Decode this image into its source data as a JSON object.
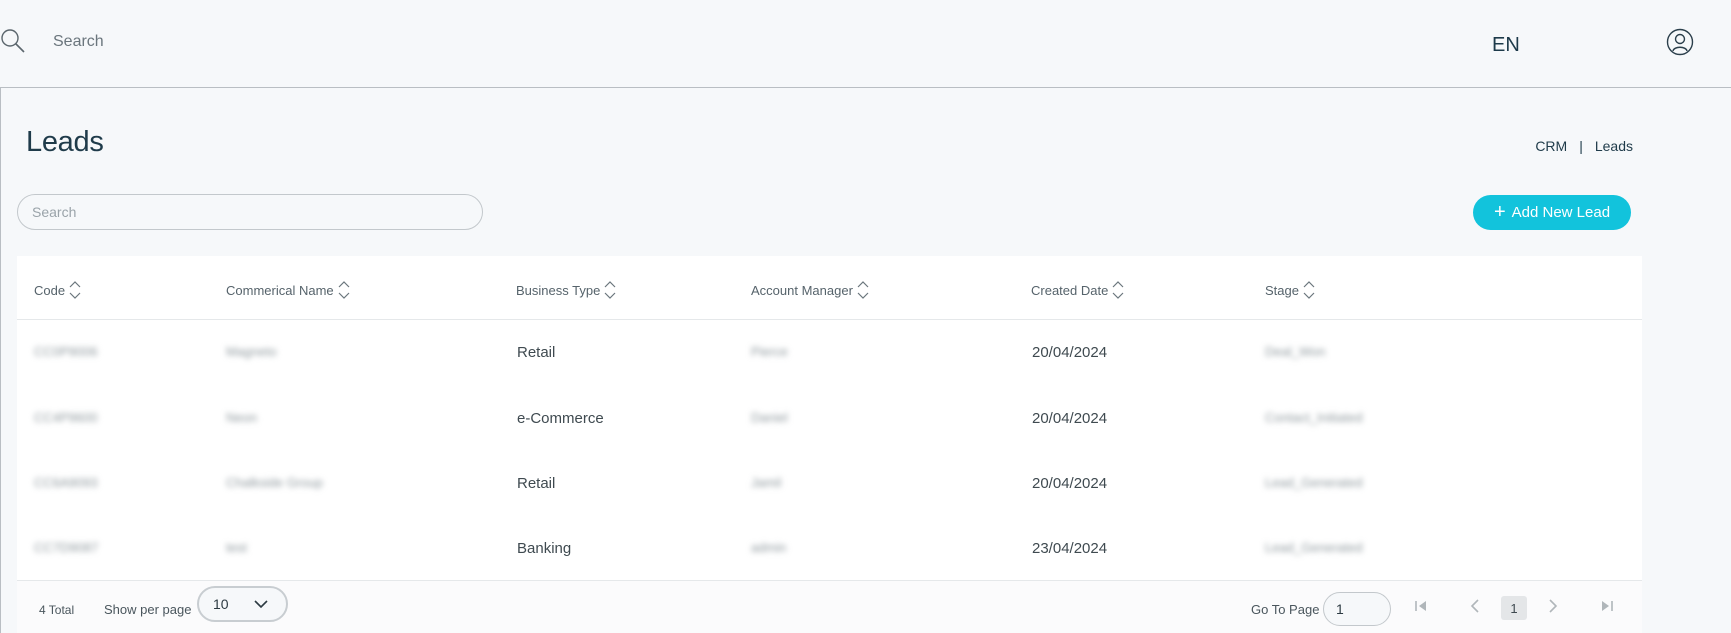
{
  "topbar": {
    "search_placeholder": "Search",
    "language": "EN",
    "icons": {
      "search": "search-icon",
      "user": "user-circle-icon"
    }
  },
  "page": {
    "title": "Leads",
    "breadcrumb": [
      "CRM",
      "|",
      "Leads"
    ]
  },
  "toolbar": {
    "search_placeholder": "Search",
    "add_button_label": "Add New Lead",
    "add_button_color": "#12c3dc"
  },
  "table": {
    "columns": [
      "Code",
      "Commerical Name",
      "Business Type",
      "Account Manager",
      "Created Date",
      "Stage"
    ],
    "rows": [
      [
        "CC0P9006",
        "Magneto",
        "Retail",
        "Pierce",
        "20/04/2024",
        "Deal_Won"
      ],
      [
        "CC4P9600",
        "Neon",
        "e-Commerce",
        "Daniel",
        "20/04/2024",
        "Contact_Initiated"
      ],
      [
        "CC6A9093",
        "Chalkside Group",
        "Retail",
        "Jamil",
        "20/04/2024",
        "Lead_Generated"
      ],
      [
        "CC7D9087",
        "test",
        "Banking",
        "admin",
        "23/04/2024",
        "Lead_Generated"
      ]
    ],
    "blurred_columns": [
      0,
      1,
      3,
      5
    ]
  },
  "pagination": {
    "total_label": "4 Total",
    "per_page_label": "Show per page",
    "per_page_value": "10",
    "goto_label": "Go To Page",
    "goto_value": "1",
    "current_page": "1"
  }
}
